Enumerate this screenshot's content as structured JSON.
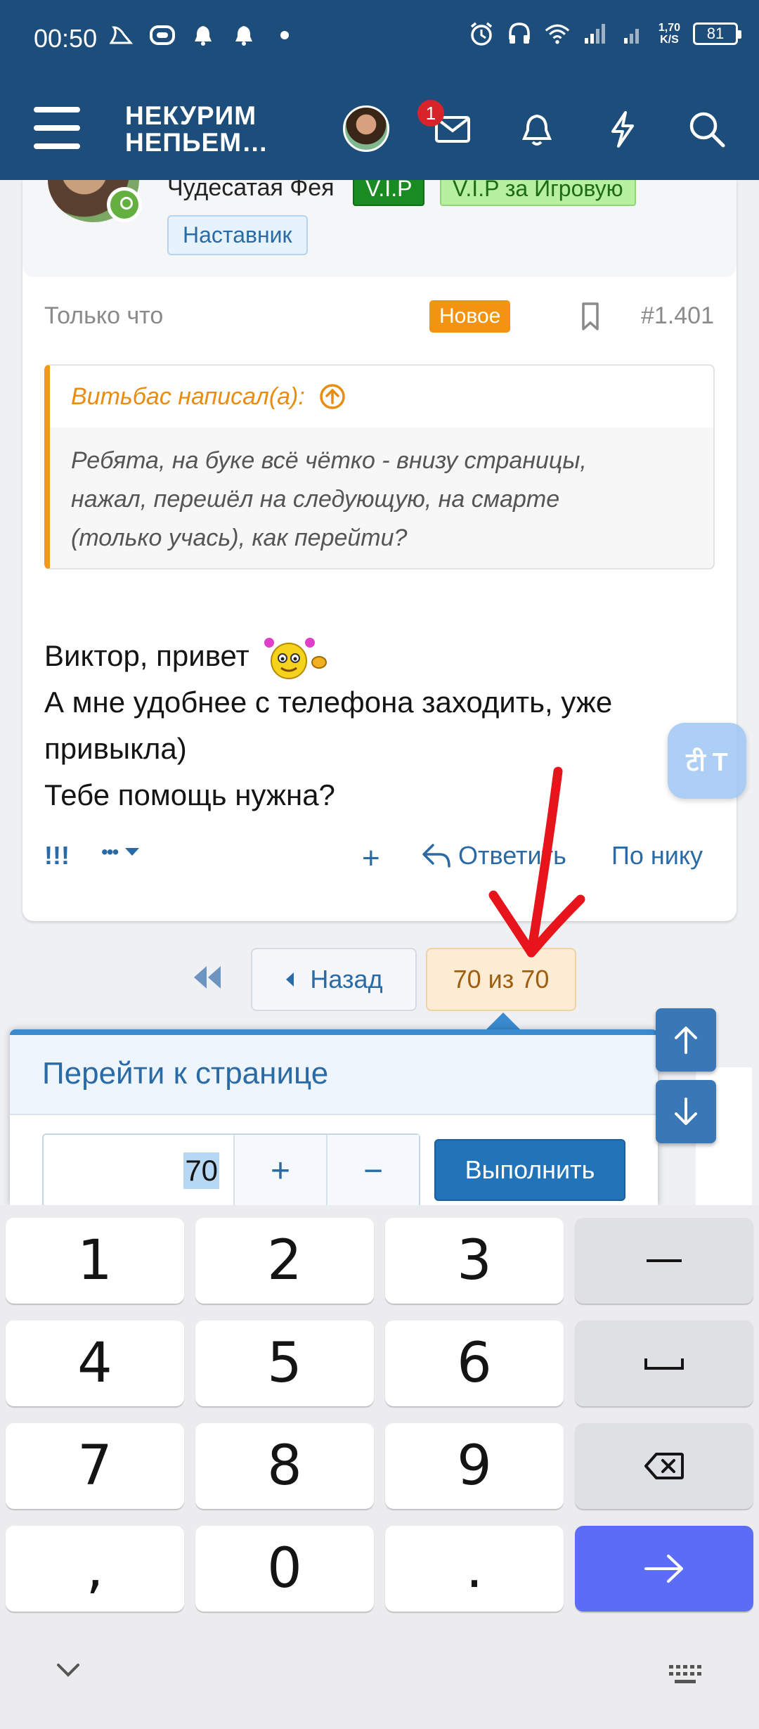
{
  "status_bar": {
    "time": "00:50",
    "net_speed_value": "1,70",
    "net_speed_unit": "K/S",
    "battery": "81"
  },
  "header": {
    "brand_line1": "НЕКУРИМ",
    "brand_line2": "НЕПЬЕМ…",
    "notification_badge": "1"
  },
  "post": {
    "author_name": "Чудесатая Фея",
    "tag_vip": "V.I.P",
    "tag_vip_game": "V.I.P за Игровую",
    "tag_mentor": "Наставник",
    "time": "Только что",
    "new_badge": "Новое",
    "number": "#1.401",
    "quote_author": "Витьбас написал(а):",
    "quote_line1": "Ребята, на буке всё чётко - внизу страницы,",
    "quote_line2": "нажал, перешёл на следующую, на смарте",
    "quote_line3": "(только учась), как перейти?",
    "text_line1": "Виктор, привет",
    "text_line2": "А мне удобнее с телефона заходить, уже",
    "text_line3": "привыкла)",
    "text_line4": "Тебе помощь нужна?",
    "actions": {
      "exclaim": "!!!",
      "more": "•••",
      "plus": "+",
      "reply": "Ответить",
      "by_nick": "По нику"
    }
  },
  "pagination": {
    "prev_label": "Назад",
    "current": "70 из 70"
  },
  "goto_popup": {
    "title": "Перейти к странице",
    "value": "70",
    "plus": "+",
    "minus": "−",
    "submit": "Выполнить"
  },
  "translate_bubble": {
    "text": "टी T"
  },
  "keyboard": {
    "keys": [
      "1",
      "2",
      "3",
      "4",
      "5",
      "6",
      "7",
      "8",
      "9",
      ",",
      "0",
      "."
    ]
  },
  "colors": {
    "header_bg": "#1d4d7a",
    "accent_blue": "#2a6aa5",
    "new_badge": "#f29411",
    "annotation_red": "#e8141b"
  }
}
